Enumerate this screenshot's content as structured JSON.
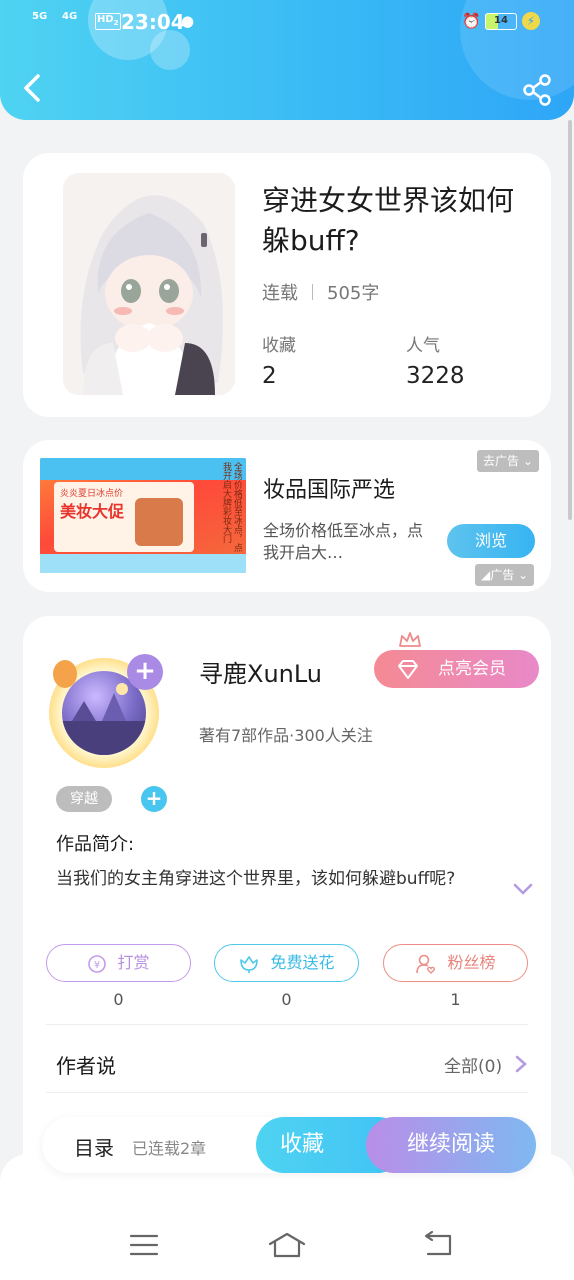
{
  "status_bar": {
    "network1": "5G",
    "network2": "4G",
    "hd": "HD",
    "hd_sub": "2",
    "time": "23:04",
    "battery": "14"
  },
  "header": {
    "back_icon": "chevron-left-icon",
    "share_icon": "share-icon"
  },
  "book": {
    "title": "穿进女女世界该如何躲buff?",
    "status": "连载",
    "word_count": "505字",
    "stats": [
      {
        "label": "收藏",
        "value": "2"
      },
      {
        "label": "人气",
        "value": "3228"
      }
    ]
  },
  "ad": {
    "title": "妆品国际严选",
    "description": "全场价格低至冰点，点我开启大…",
    "browse_label": "浏览",
    "dismiss_label": "去广告",
    "ad_label": "广告",
    "banner": {
      "headline": "美妆大促",
      "top_line": "炎炎夏日冰点价",
      "side_text": "全场价格低至冰点，点我开启大牌彩妆大门"
    }
  },
  "author": {
    "name": "寻鹿XunLu",
    "meta": "著有7部作品·300人关注",
    "vip_label": "点亮会员",
    "tag": "穿越",
    "intro_heading": "作品简介:",
    "intro_text": "当我们的女主角穿进这个世界里，该如何躲避buff呢?",
    "actions": [
      {
        "label": "打赏",
        "count": "0",
        "color": "#c49be8",
        "icon": "yen-coin-icon"
      },
      {
        "label": "免费送花",
        "count": "0",
        "color": "#4fc8ea",
        "icon": "flower-icon"
      },
      {
        "label": "粉丝榜",
        "count": "1",
        "color": "#ec8f86",
        "icon": "fan-user-icon"
      }
    ],
    "author_says": "作者说",
    "all_label": "全部(0)"
  },
  "bottom_bar": {
    "toc_label": "目录",
    "toc_count": "已连载2章",
    "favorite_label": "收藏",
    "read_label": "继续阅读"
  },
  "nav": {
    "menu_icon": "menu-icon",
    "home_icon": "home-icon",
    "back_icon": "back-icon"
  }
}
